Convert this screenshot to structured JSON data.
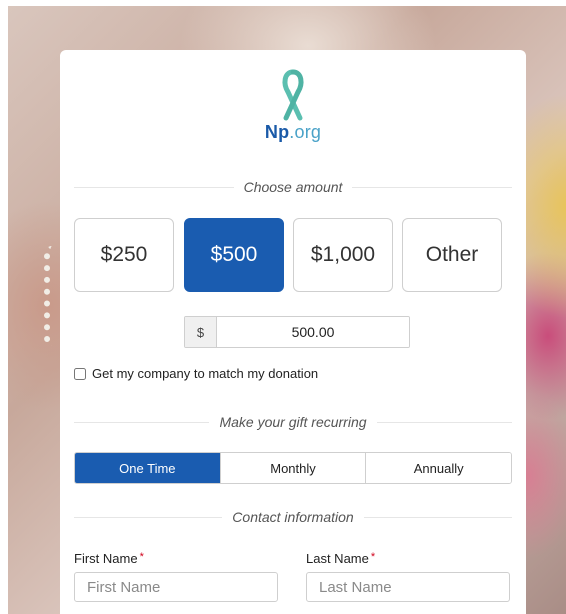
{
  "brand": {
    "logo_np": "Np",
    "logo_org": ".org",
    "ribbon_color": "#5bbfb0"
  },
  "sections": {
    "choose_amount": "Choose amount",
    "recurring": "Make your gift recurring",
    "contact": "Contact information"
  },
  "amounts": [
    {
      "label": "$250",
      "selected": false
    },
    {
      "label": "$500",
      "selected": true
    },
    {
      "label": "$1,000",
      "selected": false
    },
    {
      "label": "Other",
      "selected": false
    }
  ],
  "amount_input": {
    "currency": "$",
    "value": "500.00"
  },
  "match": {
    "label": "Get my company to match my donation",
    "checked": false
  },
  "frequency": [
    {
      "label": "One Time",
      "selected": true
    },
    {
      "label": "Monthly",
      "selected": false
    },
    {
      "label": "Annually",
      "selected": false
    }
  ],
  "contact": {
    "first_name_label": "First Name",
    "first_name_placeholder": "First Name",
    "first_name_value": "",
    "last_name_label": "Last Name",
    "last_name_placeholder": "Last Name",
    "last_name_value": "",
    "required_marker": "*"
  },
  "colors": {
    "accent": "#1a5cb0",
    "required": "#d0021b"
  }
}
